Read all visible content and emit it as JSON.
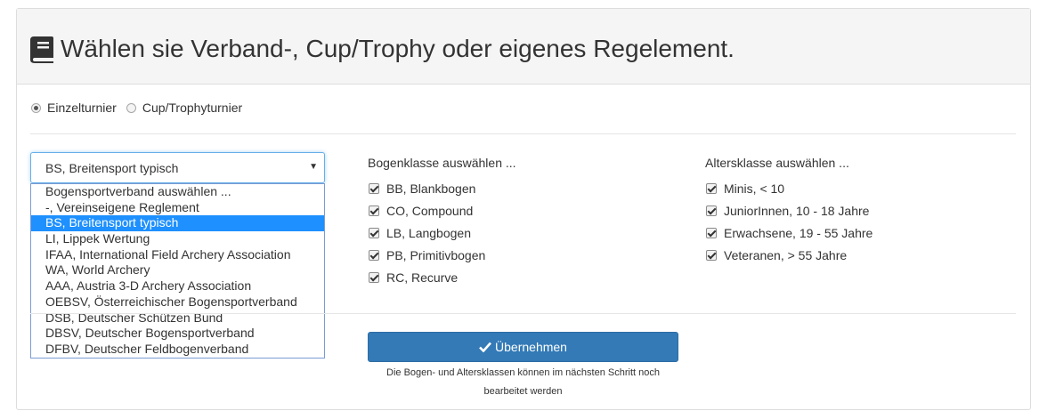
{
  "header": {
    "title": "Wählen sie Verband-, Cup/Trophy oder eigenes Regelement."
  },
  "tournament_type": {
    "options": [
      {
        "label": "Einzelturnier",
        "checked": true
      },
      {
        "label": "Cup/Trophyturnier",
        "checked": false
      }
    ]
  },
  "federation_select": {
    "value": "BS, Breitensport typisch",
    "options": [
      "Bogensportverband auswählen ...",
      "-, Vereinseigene Reglement",
      "BS, Breitensport typisch",
      "LI, Lippek Wertung",
      "IFAA, International Field Archery Association",
      "WA, World Archery",
      "AAA, Austria 3-D Archery Association",
      "OEBSV, Österreichischer Bogensportverband",
      "DSB, Deutscher Schützen Bund",
      "DBSV, Deutscher Bogensportverband",
      "DFBV, Deutscher Feldbogenverband"
    ],
    "highlighted_index": 2
  },
  "bow_classes": {
    "title": "Bogenklasse auswählen ...",
    "items": [
      {
        "label": "BB, Blankbogen",
        "checked": true
      },
      {
        "label": "CO, Compound",
        "checked": true
      },
      {
        "label": "LB, Langbogen",
        "checked": true
      },
      {
        "label": "PB, Primitivbogen",
        "checked": true
      },
      {
        "label": "RC, Recurve",
        "checked": true
      }
    ]
  },
  "age_classes": {
    "title": "Altersklasse auswählen ...",
    "items": [
      {
        "label": "Minis, < 10",
        "checked": true
      },
      {
        "label": "JuniorInnen, 10 - 18 Jahre",
        "checked": true
      },
      {
        "label": "Erwachsene, 19 - 55 Jahre",
        "checked": true
      },
      {
        "label": "Veteranen, > 55 Jahre",
        "checked": true
      }
    ]
  },
  "submit": {
    "label": "Übernehmen",
    "hint_line1": "Die Bogen- und Altersklassen können im nächsten Schritt noch",
    "hint_line2": "bearbeitet werden"
  },
  "colors": {
    "primary": "#337ab7",
    "highlight": "#1e90ff",
    "heading_bg": "#f5f5f5"
  }
}
